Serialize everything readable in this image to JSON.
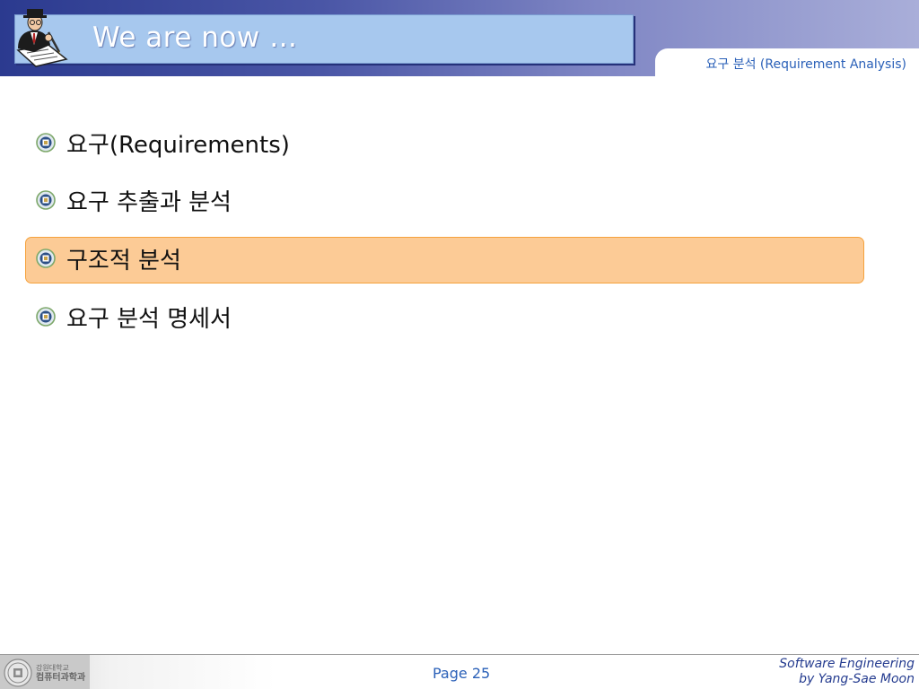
{
  "header": {
    "title": "We are now …",
    "section_label": "요구 분석 (Requirement Analysis)"
  },
  "bullets": [
    {
      "text": "요구(Requirements)",
      "highlighted": false
    },
    {
      "text": "요구 추출과 분석",
      "highlighted": false
    },
    {
      "text": "구조적 분석",
      "highlighted": true
    },
    {
      "text": "요구 분석 명세서",
      "highlighted": false
    }
  ],
  "footer": {
    "logo_line1": "강원대학교",
    "logo_line2": "컴퓨터과학과",
    "page": "Page 25",
    "course": "Software Engineering",
    "author": "by Yang-Sae Moon"
  },
  "colors": {
    "header_gradient_start": "#2b3a8f",
    "title_box": "#a7c8ee",
    "highlight_fill": "#fccb96",
    "highlight_border": "#f5a23c",
    "accent_text": "#2a60b8"
  }
}
